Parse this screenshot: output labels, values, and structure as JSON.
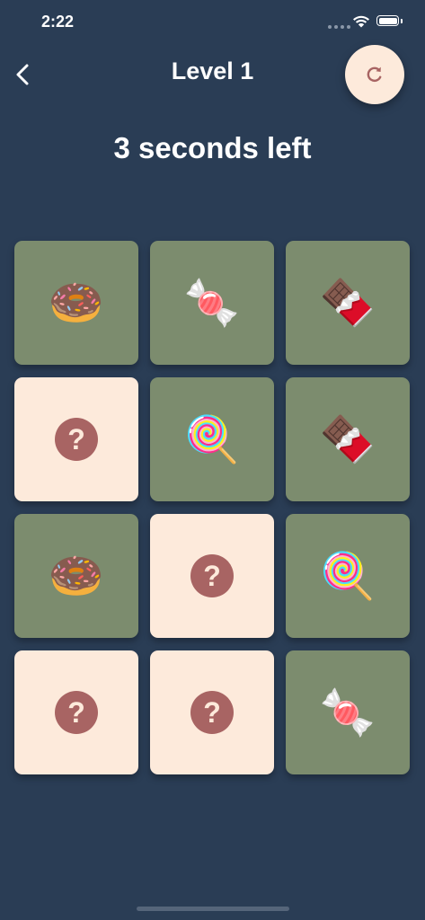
{
  "status_bar": {
    "time": "2:22"
  },
  "header": {
    "title": "Level 1",
    "back_icon": "chevron-left-icon",
    "restart_icon": "restart-icon"
  },
  "timer_text": "3 seconds left",
  "colors": {
    "background": "#2a3d55",
    "card_revealed": "#7c8c6e",
    "card_hidden": "#fdeadb",
    "question_mark": "#a86463"
  },
  "cards": [
    {
      "state": "revealed",
      "item": "donut",
      "emoji": "🍩"
    },
    {
      "state": "revealed",
      "item": "candy",
      "emoji": "🍬"
    },
    {
      "state": "revealed",
      "item": "chocolate",
      "emoji": "🍫"
    },
    {
      "state": "hidden",
      "item": "unknown",
      "symbol": "?"
    },
    {
      "state": "revealed",
      "item": "lollipop",
      "emoji": "🍭"
    },
    {
      "state": "revealed",
      "item": "chocolate",
      "emoji": "🍫"
    },
    {
      "state": "revealed",
      "item": "donut",
      "emoji": "🍩"
    },
    {
      "state": "hidden",
      "item": "unknown",
      "symbol": "?"
    },
    {
      "state": "revealed",
      "item": "lollipop",
      "emoji": "🍭"
    },
    {
      "state": "hidden",
      "item": "unknown",
      "symbol": "?"
    },
    {
      "state": "hidden",
      "item": "unknown",
      "symbol": "?"
    },
    {
      "state": "revealed",
      "item": "candy",
      "emoji": "🍬"
    }
  ]
}
